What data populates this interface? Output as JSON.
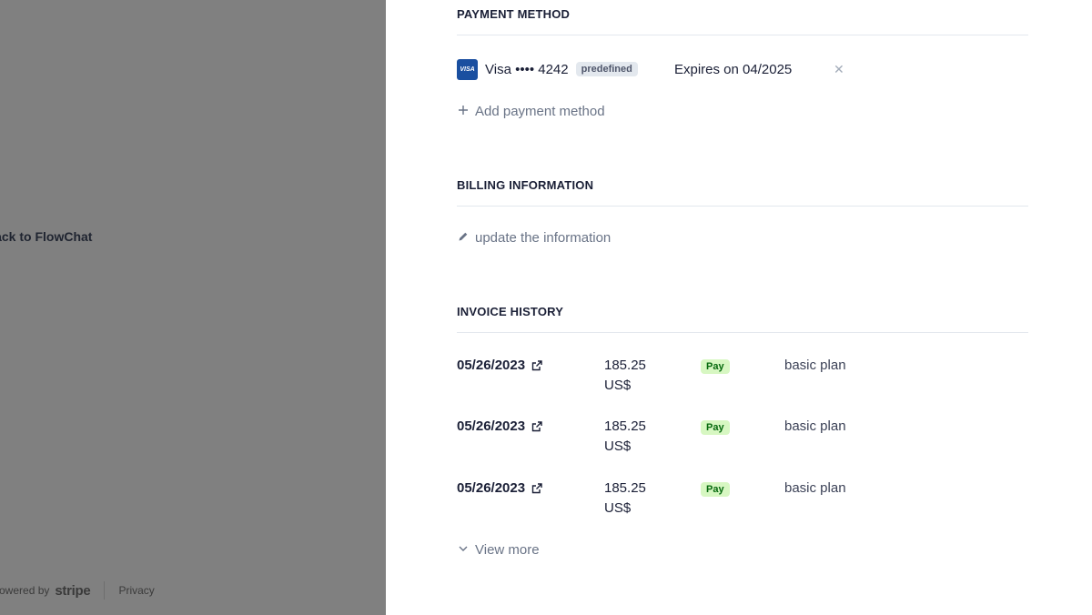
{
  "left": {
    "back_label": "Back to FlowChat",
    "footer": {
      "powered_by": "Powered by",
      "brand": "stripe",
      "privacy": "Privacy"
    }
  },
  "payment_method": {
    "title": "PAYMENT METHOD",
    "card": {
      "logo": "VISA",
      "text": "Visa •••• 4242",
      "badge": "predefined",
      "expires": "Expires on 04/2025",
      "remove_icon": "close-icon"
    },
    "add_label": "Add payment method"
  },
  "billing": {
    "title": "BILLING INFORMATION",
    "update_label": "update the information"
  },
  "invoices": {
    "title": "INVOICE HISTORY",
    "rows": [
      {
        "date": "05/26/2023",
        "amount_line1": "185.25",
        "amount_line2": "US$",
        "status": "Pay",
        "plan": "basic plan"
      },
      {
        "date": "05/26/2023",
        "amount_line1": "185.25",
        "amount_line2": "US$",
        "status": "Pay",
        "plan": "basic plan"
      },
      {
        "date": "05/26/2023",
        "amount_line1": "185.25",
        "amount_line2": "US$",
        "status": "Pay",
        "plan": "basic plan"
      }
    ],
    "view_more_label": "View more"
  },
  "colors": {
    "overlay": "#808080",
    "text_primary": "#1a1f36",
    "text_muted": "#697386",
    "status_pay_bg": "#d7f7c2",
    "status_pay_fg": "#05690d",
    "visa_blue": "#1a4fa0"
  }
}
